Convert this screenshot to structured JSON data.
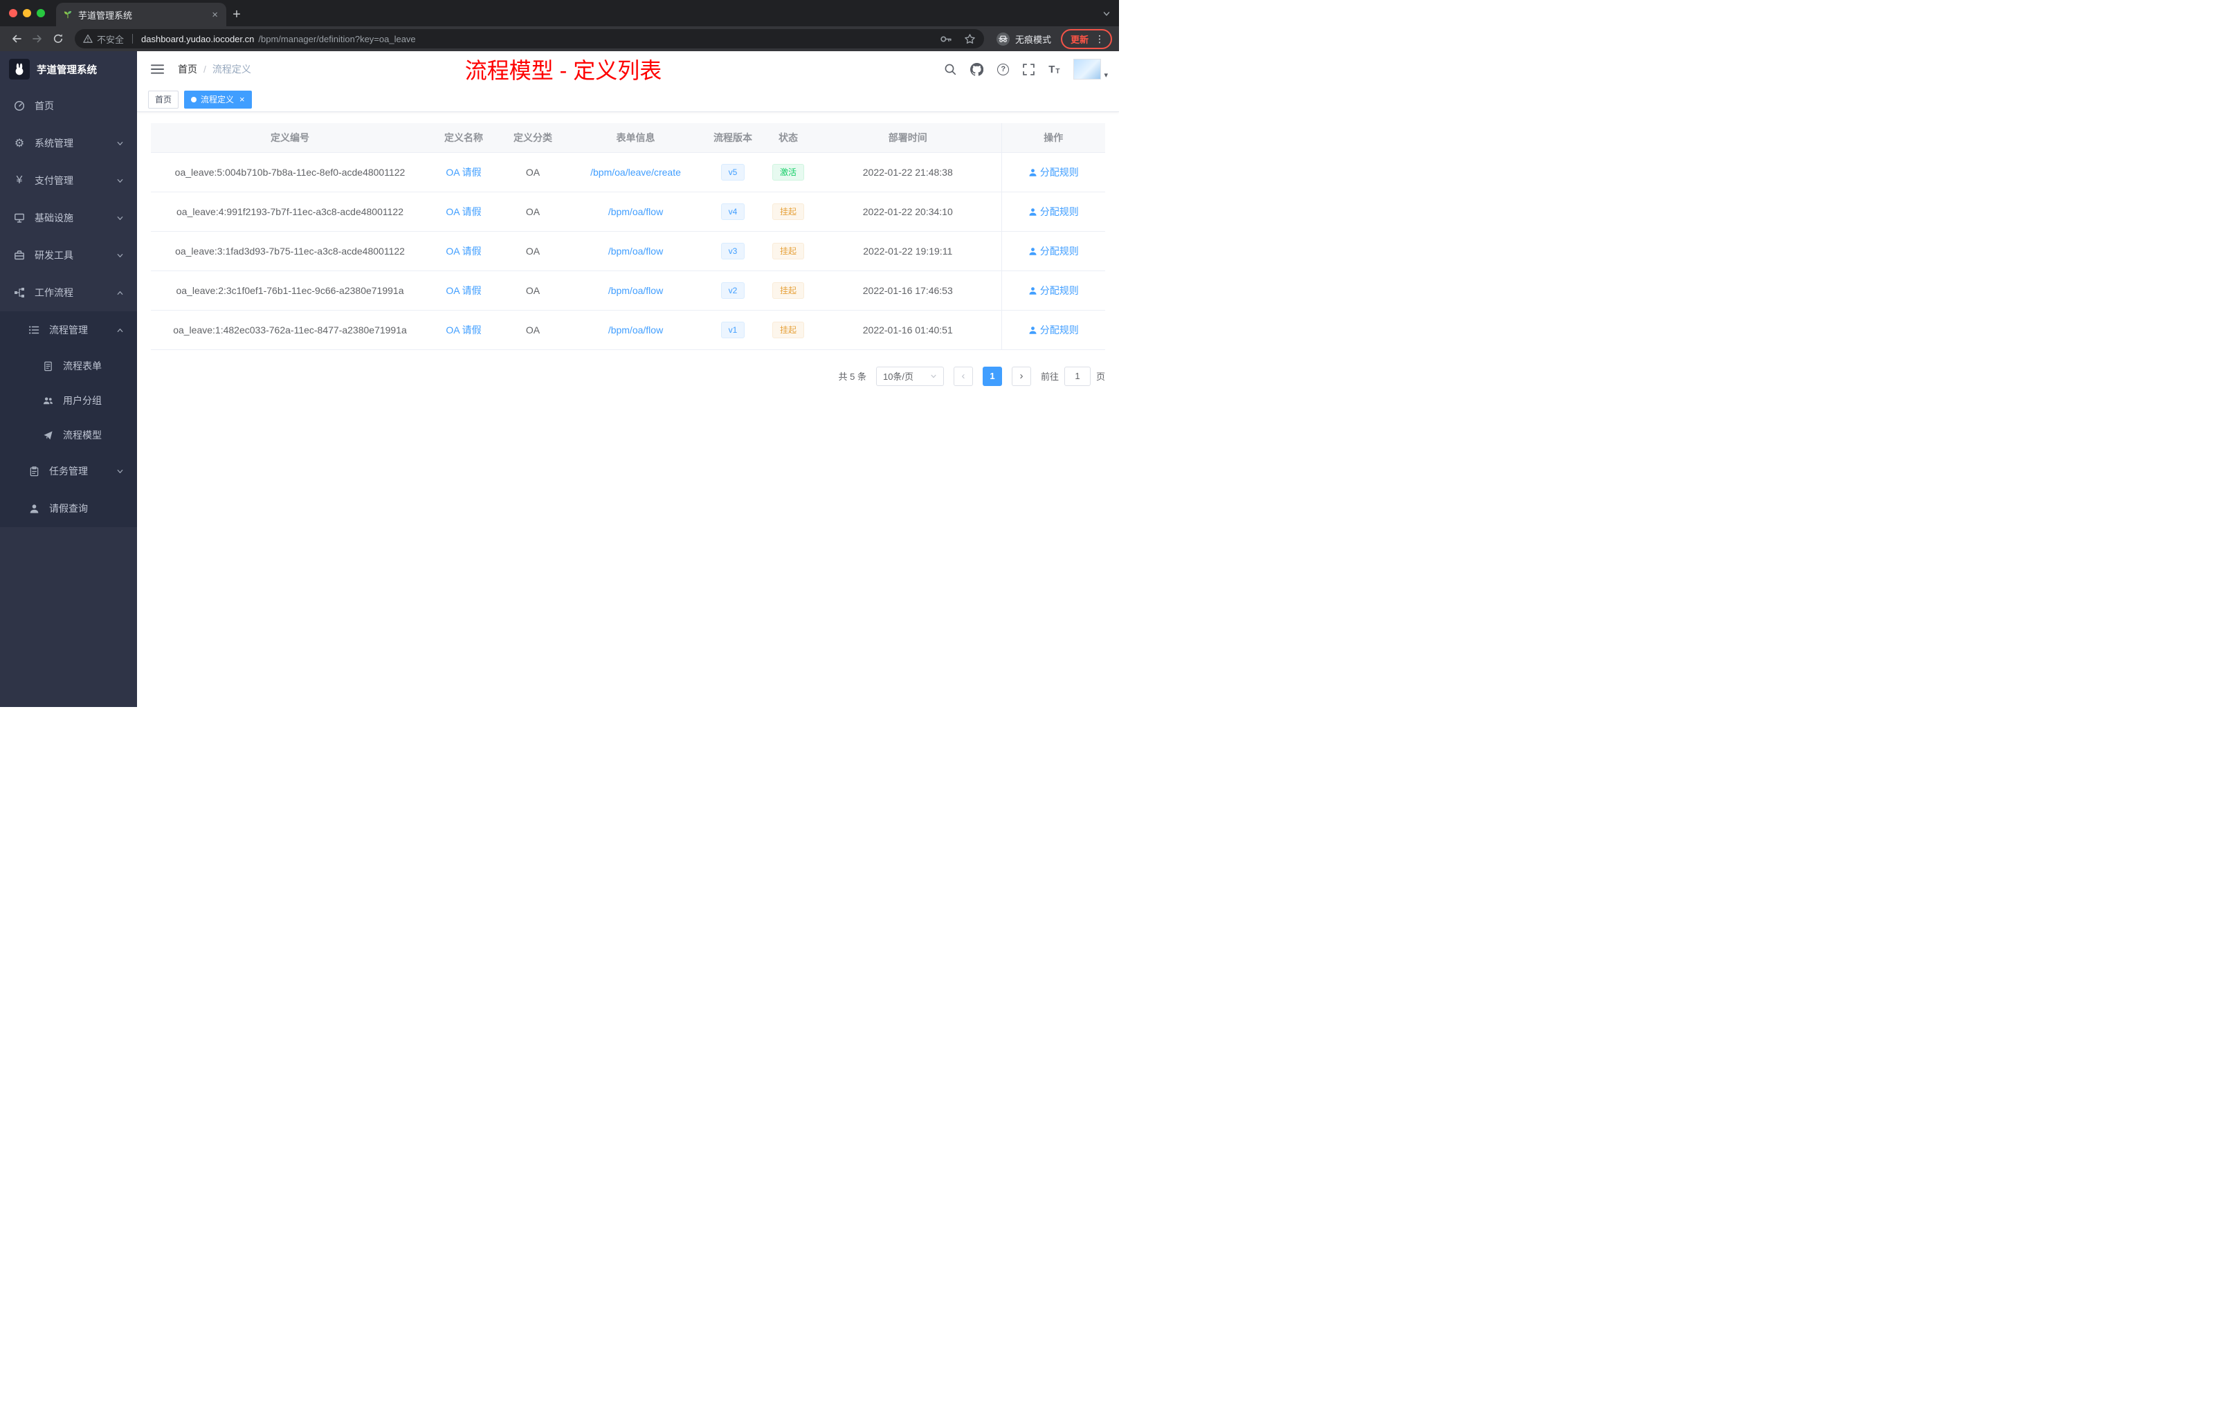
{
  "colors": {
    "accent": "#409eff",
    "success": "#13ce66",
    "warning": "#e6a23c",
    "annotation_red": "#fe0000",
    "sidebar_bg": "#2f3447"
  },
  "browser": {
    "tab_title": "芋道管理系统",
    "security_label": "不安全",
    "url_host": "dashboard.yudao.iocoder.cn",
    "url_path": "/bpm/manager/definition?key=oa_leave",
    "incognito_label": "无痕模式",
    "update_label": "更新"
  },
  "sidebar": {
    "app_title": "芋道管理系统",
    "items": [
      {
        "label": "首页"
      },
      {
        "label": "系统管理"
      },
      {
        "label": "支付管理"
      },
      {
        "label": "基础设施"
      },
      {
        "label": "研发工具"
      },
      {
        "label": "工作流程"
      }
    ],
    "submenu": {
      "label": "流程管理",
      "children": [
        {
          "label": "流程表单"
        },
        {
          "label": "用户分组"
        },
        {
          "label": "流程模型"
        }
      ]
    },
    "task_mgmt": {
      "label": "任务管理"
    },
    "leave_query": {
      "label": "请假查询"
    }
  },
  "header": {
    "breadcrumb_home": "首页",
    "breadcrumb_current": "流程定义",
    "annotation_title": "流程模型 - 定义列表"
  },
  "tags_bar": {
    "tags": [
      {
        "label": "首页",
        "active": false
      },
      {
        "label": "流程定义",
        "active": true
      }
    ]
  },
  "table": {
    "columns": [
      "定义编号",
      "定义名称",
      "定义分类",
      "表单信息",
      "流程版本",
      "状态",
      "部署时间",
      "操作"
    ],
    "rows": [
      {
        "id": "oa_leave:5:004b710b-7b8a-11ec-8ef0-acde48001122",
        "name": "OA 请假",
        "category": "OA",
        "form": "/bpm/oa/leave/create",
        "version": "v5",
        "status": "激活",
        "status_type": "success",
        "deploy_time": "2022-01-22 21:48:38",
        "action": "分配规则"
      },
      {
        "id": "oa_leave:4:991f2193-7b7f-11ec-a3c8-acde48001122",
        "name": "OA 请假",
        "category": "OA",
        "form": "/bpm/oa/flow",
        "version": "v4",
        "status": "挂起",
        "status_type": "warning",
        "deploy_time": "2022-01-22 20:34:10",
        "action": "分配规则"
      },
      {
        "id": "oa_leave:3:1fad3d93-7b75-11ec-a3c8-acde48001122",
        "name": "OA 请假",
        "category": "OA",
        "form": "/bpm/oa/flow",
        "version": "v3",
        "status": "挂起",
        "status_type": "warning",
        "deploy_time": "2022-01-22 19:19:11",
        "action": "分配规则"
      },
      {
        "id": "oa_leave:2:3c1f0ef1-76b1-11ec-9c66-a2380e71991a",
        "name": "OA 请假",
        "category": "OA",
        "form": "/bpm/oa/flow",
        "version": "v2",
        "status": "挂起",
        "status_type": "warning",
        "deploy_time": "2022-01-16 17:46:53",
        "action": "分配规则"
      },
      {
        "id": "oa_leave:1:482ec033-762a-11ec-8477-a2380e71991a",
        "name": "OA 请假",
        "category": "OA",
        "form": "/bpm/oa/flow",
        "version": "v1",
        "status": "挂起",
        "status_type": "warning",
        "deploy_time": "2022-01-16 01:40:51",
        "action": "分配规则"
      }
    ]
  },
  "pagination": {
    "total_text": "共 5 条",
    "page_size_text": "10条/页",
    "current_page": "1",
    "goto_label": "前往",
    "goto_value": "1",
    "page_unit": "页"
  }
}
